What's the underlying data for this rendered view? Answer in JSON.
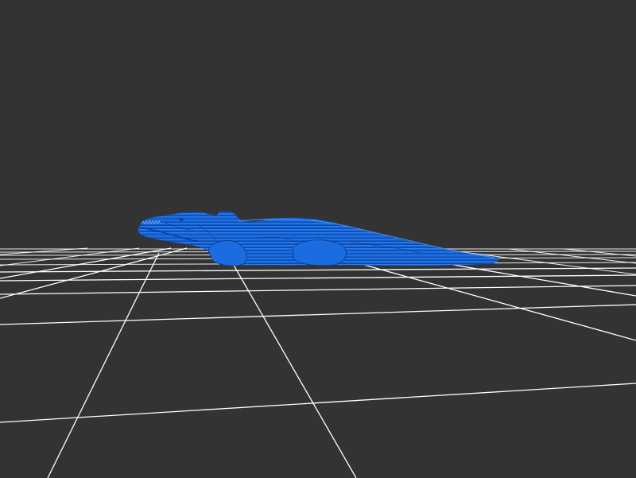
{
  "viewer": {
    "background_color": "#333333",
    "grid_color": "#ffffff",
    "model_color": "#1565d8",
    "model_highlight_color": "#2f86ff",
    "model_shadow_color": "#0b3f96",
    "model_icon": "dinosaur-model"
  }
}
